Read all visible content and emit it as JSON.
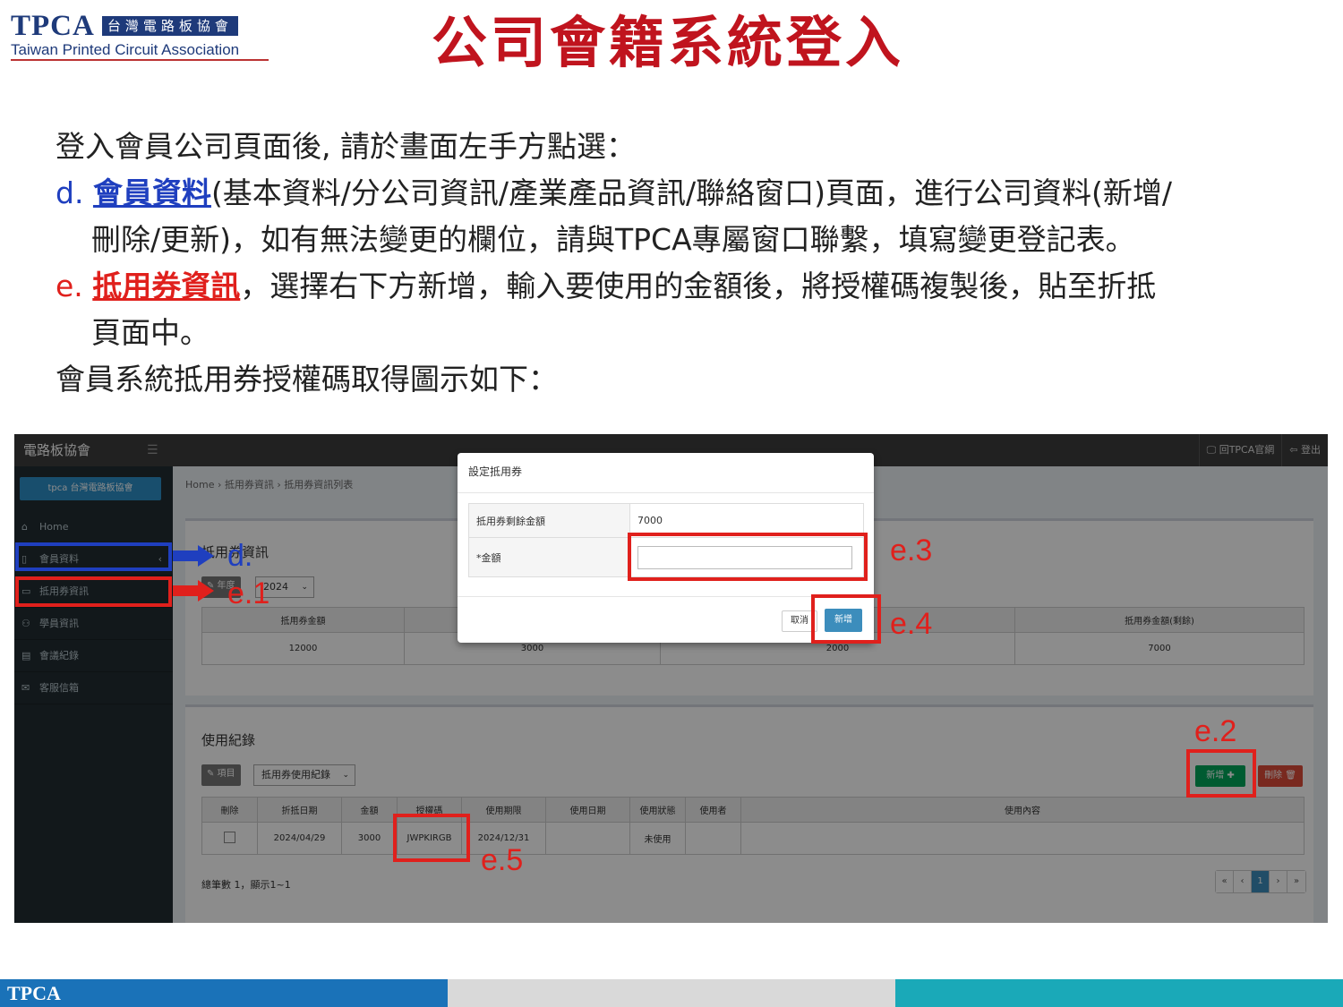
{
  "logo": {
    "abbr": "TPCA",
    "chinese": "台灣電路板協會",
    "english": "Taiwan Printed Circuit Association"
  },
  "slide_title": "公司會籍系統登入",
  "instructions": {
    "line1": "登入會員公司頁面後, 請於畫面左手方點選：",
    "d_label": "d.",
    "d_highlight": "會員資料",
    "d_text_a": "(基本資料/分公司資訊/產業產品資訊/聯絡窗口)頁面，進行公司資料(新增/",
    "d_text_b": "刪除/更新)，如有無法變更的欄位，請與TPCA專屬窗口聯繫，填寫變更登記表。",
    "e_label": "e.",
    "e_highlight": "抵用券資訊",
    "e_text_a": "，選擇右下方新增，輸入要使用的金額後，將授權碼複製後，貼至折抵",
    "e_text_b": "頁面中。",
    "last": "會員系統抵用券授權碼取得圖示如下："
  },
  "screenshot": {
    "brand": "電路板協會",
    "menu_icon": "hamburger-icon",
    "top_links": [
      "🖵 回TPCA官網",
      "⇦ 登出"
    ],
    "company_button": "tpca 台灣電路板協會",
    "sidebar": {
      "home": "Home",
      "member": "會員資料",
      "voucher": "抵用券資訊",
      "student": "學員資訊",
      "meeting": "會議紀錄",
      "service": "客服信箱"
    },
    "breadcrumb": "Home  ›  抵用券資訊  ›  抵用券資訊列表",
    "box1": {
      "title": "抵用券資訊",
      "year_button": "✎ 年度",
      "year_value": "2024",
      "headers": [
        "抵用券金額",
        "",
        "",
        "抵用券金額(剩餘)"
      ],
      "row": [
        "12000",
        "3000",
        "2000",
        "7000"
      ]
    },
    "box2": {
      "title": "使用紀錄",
      "item_button": "✎ 項目",
      "item_select": "抵用券使用紀錄",
      "add_button": "新增 ✚",
      "delete_button": "刪除 🗑",
      "headers": [
        "刪除",
        "折抵日期",
        "金額",
        "授權碼",
        "使用期限",
        "使用日期",
        "使用狀態",
        "使用者",
        "使用內容"
      ],
      "row": [
        "",
        "2024/04/29",
        "3000",
        "JWPKIRGB",
        "2024/12/31",
        "",
        "未使用",
        "",
        ""
      ],
      "total": "總筆數 1，顯示1~1",
      "pager": [
        "«",
        "‹",
        "1",
        "›",
        "»"
      ]
    },
    "modal": {
      "title": "設定抵用券",
      "remaining_label": "抵用券剩餘金額",
      "remaining_value": "7000",
      "amount_label": "*金額",
      "amount_value": "",
      "cancel_button": "取消",
      "confirm_button": "新增"
    }
  },
  "annotations": {
    "d": "d.",
    "e1": "e.1",
    "e2": "e.2",
    "e3": "e.3",
    "e4": "e.4",
    "e5": "e.5"
  },
  "footer": {
    "label": "TPCA"
  },
  "colors": {
    "title_red": "#c0141e",
    "blue": "#1f3fbf",
    "red": "#e0201c",
    "navy": "#1e3a7a"
  }
}
